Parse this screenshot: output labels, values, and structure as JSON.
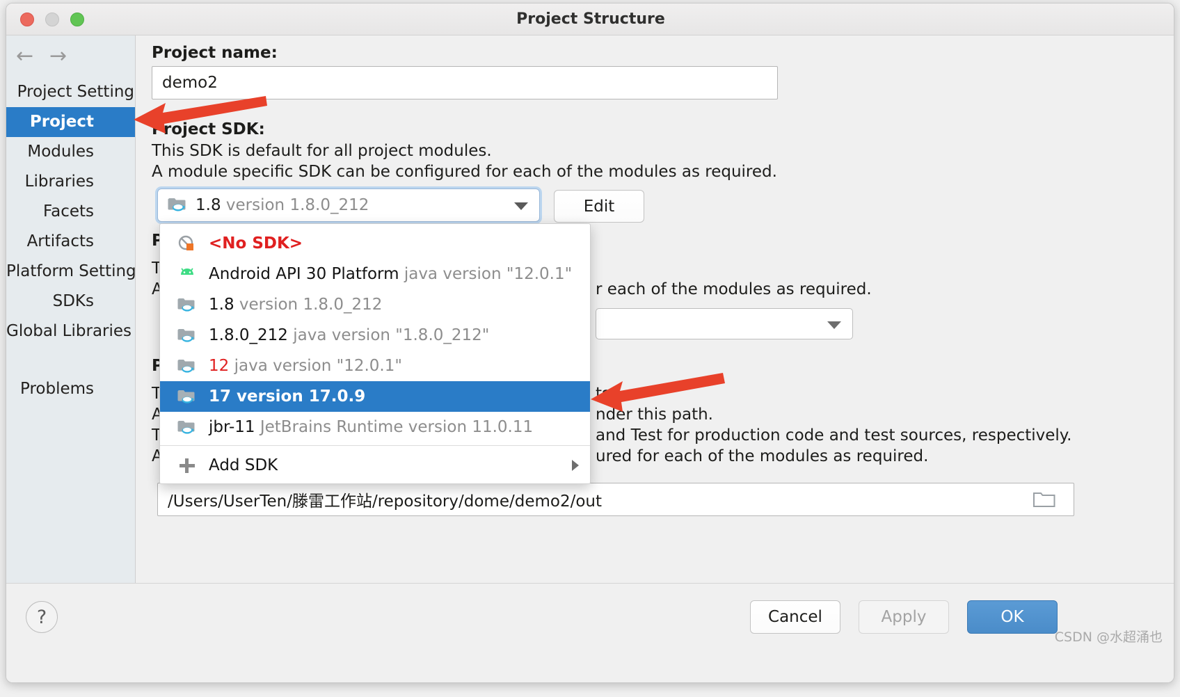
{
  "window": {
    "title": "Project Structure",
    "traffic_lights": [
      "close",
      "minimize",
      "maximize"
    ]
  },
  "sidebar": {
    "nav": {
      "back": "←",
      "forward": "→"
    },
    "items": [
      {
        "label": "Project Settings",
        "type": "group",
        "selected": false
      },
      {
        "label": "Project",
        "type": "child",
        "selected": true
      },
      {
        "label": "Modules",
        "type": "child",
        "selected": false
      },
      {
        "label": "Libraries",
        "type": "child",
        "selected": false
      },
      {
        "label": "Facets",
        "type": "child",
        "selected": false
      },
      {
        "label": "Artifacts",
        "type": "child",
        "selected": false
      },
      {
        "label": "Platform Settings",
        "type": "group",
        "selected": false
      },
      {
        "label": "SDKs",
        "type": "child",
        "selected": false
      },
      {
        "label": "Global Libraries",
        "type": "child",
        "selected": false
      },
      {
        "label": "Problems",
        "type": "child",
        "selected": false
      }
    ]
  },
  "main": {
    "project_name_label": "Project name:",
    "project_name_value": "demo2",
    "project_sdk_label": "Project SDK:",
    "sdk_desc_line1": "This SDK is default for all project modules.",
    "sdk_desc_line2": "A module specific SDK can be configured for each of the modules as required.",
    "sdk_selected": {
      "name": "1.8",
      "version": "version 1.8.0_212"
    },
    "edit_button": "Edit",
    "obscured": {
      "p1": "P",
      "t1": "T",
      "a1": "A",
      "a1_tail": "r each of the modules as required.",
      "p2": "P",
      "t2": "T",
      "t2_tail": "ts.",
      "a2": "A",
      "a2_tail": "nder this path.",
      "t3": "T",
      "t3_tail": "and Test for production code and test sources, respectively.",
      "a3": "A",
      "a3_tail": "ured for each of the modules as required."
    },
    "output_path": "/Users/UserTen/滕雷工作站/repository/dome/demo2/out",
    "browse_icon": "folder-icon"
  },
  "sdk_popup": {
    "items": [
      {
        "name": "<No SDK>",
        "detail": "",
        "icon": "no-sdk-icon",
        "style": "red",
        "selected": false
      },
      {
        "name": "Android API 30 Platform",
        "detail": "java version \"12.0.1\"",
        "icon": "android-icon",
        "style": "normal",
        "selected": false
      },
      {
        "name": "1.8",
        "detail": "version 1.8.0_212",
        "icon": "jdk-icon",
        "style": "normal",
        "selected": false
      },
      {
        "name": "1.8.0_212",
        "detail": "java version \"1.8.0_212\"",
        "icon": "jdk-icon",
        "style": "normal",
        "selected": false
      },
      {
        "name": "12",
        "detail": "java version \"12.0.1\"",
        "icon": "jdk-icon",
        "style": "red-name",
        "selected": false
      },
      {
        "name": "17",
        "detail": "version 17.0.9",
        "icon": "jdk-icon",
        "style": "normal",
        "selected": true
      },
      {
        "name": "jbr-11",
        "detail": "JetBrains Runtime version 11.0.11",
        "icon": "jdk-icon",
        "style": "normal",
        "selected": false
      }
    ],
    "add_sdk_label": "Add SDK",
    "add_sdk_icon": "plus-icon",
    "add_sdk_submenu_icon": "submenu-arrow-icon"
  },
  "footer": {
    "help_label": "?",
    "cancel_label": "Cancel",
    "apply_label": "Apply",
    "ok_label": "OK",
    "watermark": "CSDN @水超涌也"
  },
  "colors": {
    "accent_blue": "#2a7cc7",
    "primary_button": "#5b9bd5",
    "annotation_red": "#e8412a",
    "red_text": "#e02020",
    "dim_text": "#8d8d8d"
  }
}
